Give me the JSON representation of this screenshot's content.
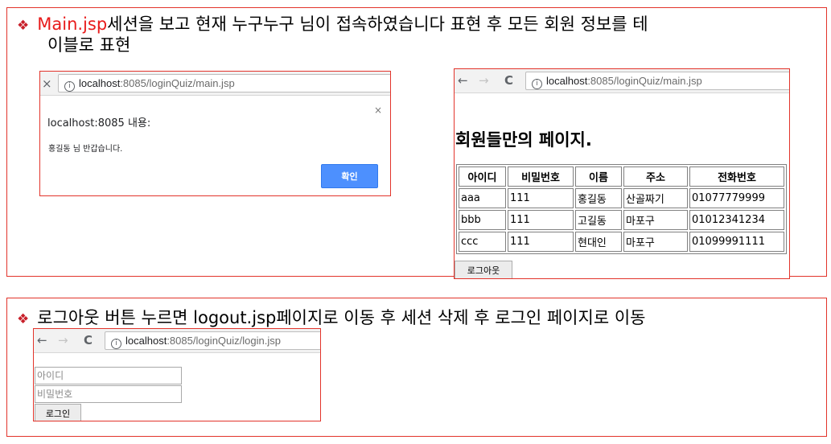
{
  "section1": {
    "bullet": "❖",
    "highlight": "Main.jsp",
    "line1_rest": "세션을 보고 현재 누구누구 님이 접속하였습니다 표현 후 모든 회원 정보를 테",
    "line2": "이블로 표현"
  },
  "section2": {
    "bullet": "❖",
    "text": "로그아웃 버튼 누르면 logout.jsp페이지로 이동 후 세션 삭제 후 로그인 페이지로 이동"
  },
  "browser_a": {
    "close_icon": "×",
    "host": "localhost",
    "path": ":8085/loginQuiz/main.jsp",
    "alert_title": "localhost:8085 내용:",
    "alert_close": "×",
    "alert_message": "홍길동 님 반갑습니다.",
    "alert_ok": "확인"
  },
  "browser_b": {
    "back": "←",
    "forward": "→",
    "reload": "C",
    "host": "localhost",
    "path": ":8085/loginQuiz/main.jsp",
    "page_title": "회원들만의 페이지.",
    "table": {
      "headers": [
        "아이디",
        "비밀번호",
        "이름",
        "주소",
        "전화번호"
      ],
      "rows": [
        [
          "aaa",
          "111",
          "홍길동",
          "산골짜기",
          "01077779999"
        ],
        [
          "bbb",
          "111",
          "고길동",
          "마포구",
          "01012341234"
        ],
        [
          "ccc",
          "111",
          "현대인",
          "마포구",
          "01099991111"
        ]
      ]
    },
    "logout_label": "로그아웃"
  },
  "browser_c": {
    "back": "←",
    "forward": "→",
    "reload": "C",
    "host": "localhost",
    "path": ":8085/loginQuiz/login.jsp",
    "id_placeholder": "아이디",
    "pw_placeholder": "비밀번호",
    "login_label": "로그인"
  },
  "colors": {
    "border": "#e2342b",
    "highlight": "#e81b1b",
    "alert_button": "#4d90fe"
  },
  "icons": [
    "info-icon",
    "back-icon",
    "forward-icon",
    "reload-icon",
    "close-icon"
  ]
}
